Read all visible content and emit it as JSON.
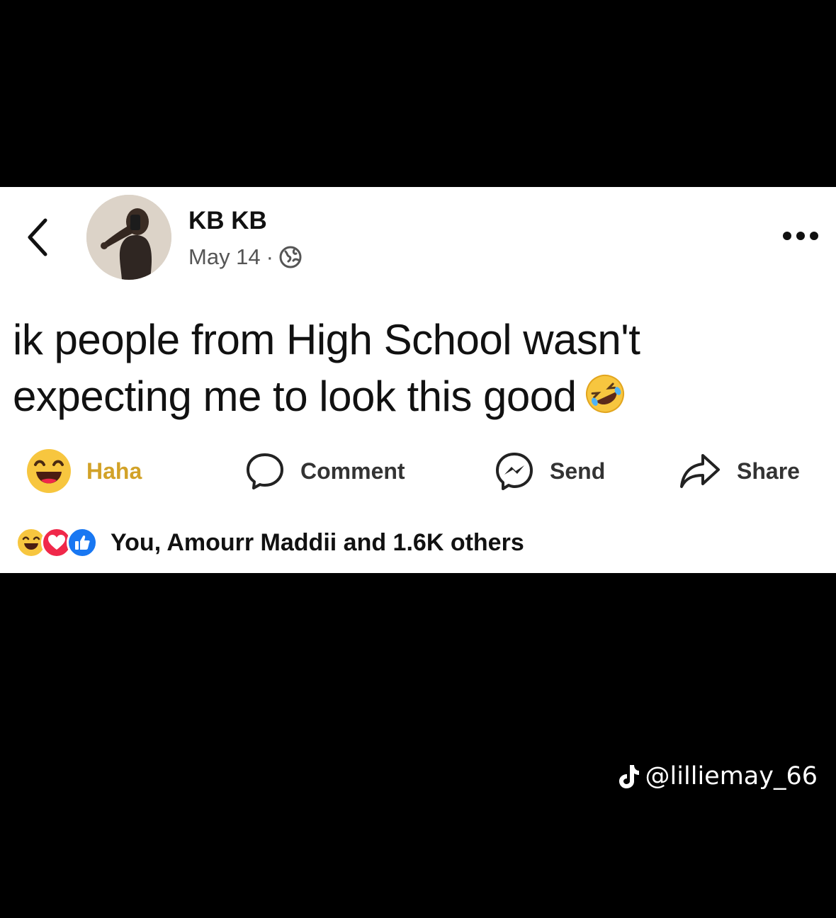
{
  "post": {
    "author_name": "KB KB",
    "date": "May 14",
    "separator": "·",
    "text_line_1": "ik people from High School wasn't",
    "text_line_2": "expecting me to look this good"
  },
  "actions": {
    "haha_label": "Haha",
    "comment_label": "Comment",
    "send_label": "Send",
    "share_label": "Share"
  },
  "reactions": {
    "summary": "You, Amourr Maddii and 1.6K others"
  },
  "watermark": {
    "handle": "@lilliemay_66"
  },
  "colors": {
    "haha_yellow": "#f7c63f",
    "haha_label": "#d2a228",
    "love_red": "#f0284a",
    "like_blue": "#1877f2"
  },
  "icons": [
    "back-icon",
    "globe-icon",
    "more-icon",
    "rofl-emoji-icon",
    "haha-icon",
    "comment-icon",
    "messenger-icon",
    "share-icon",
    "love-icon",
    "like-icon",
    "tiktok-icon"
  ]
}
